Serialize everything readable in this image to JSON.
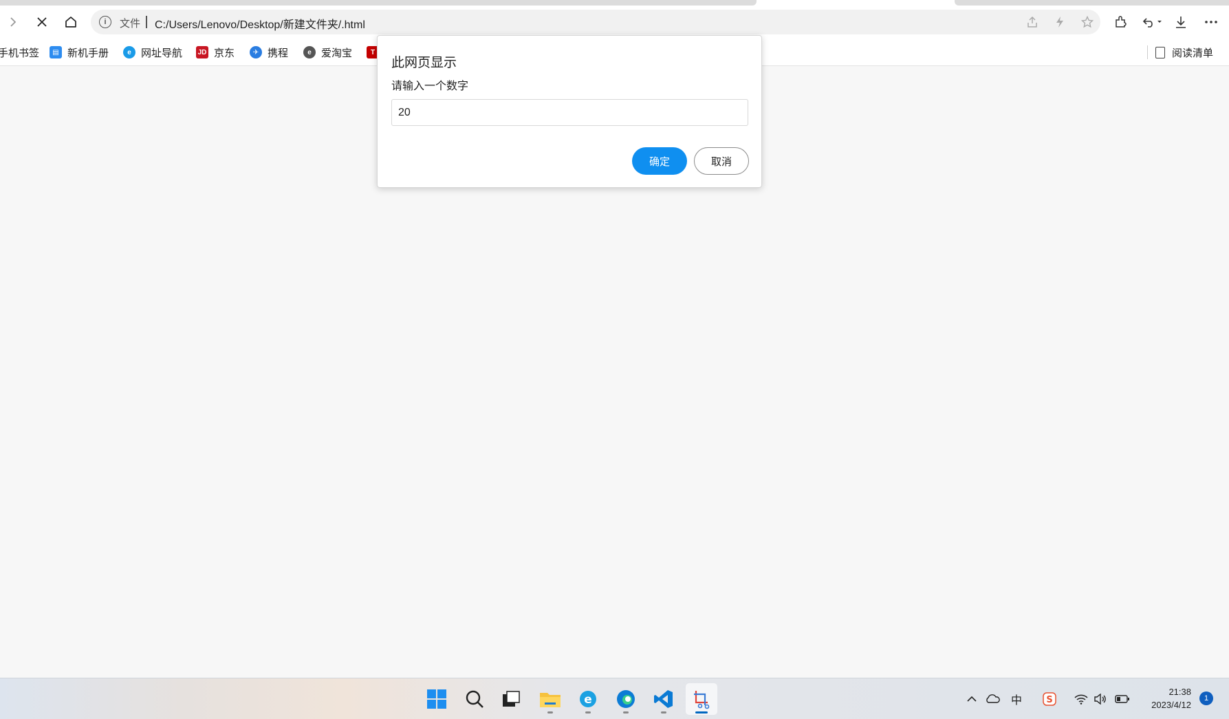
{
  "browser": {
    "address": {
      "file_label": "文件",
      "url": "C:/Users/Lenovo/Desktop/新建文件夹/.html"
    },
    "toolbar_icons": [
      "forward-icon",
      "close-icon",
      "home-icon",
      "info-icon",
      "share-icon",
      "bolt-icon",
      "favorite-star-icon",
      "extensions-icon",
      "undo-icon",
      "download-icon",
      "more-icon"
    ]
  },
  "bookmarks": [
    {
      "label": "手机书签",
      "icon": "phone-bookmark-icon"
    },
    {
      "label": "新机手册",
      "icon": "manual-icon",
      "color": "#2d8cf0"
    },
    {
      "label": "网址导航",
      "icon": "nav-icon",
      "color": "#1a9be8"
    },
    {
      "label": "京东",
      "icon": "jd-icon",
      "color": "#c81623"
    },
    {
      "label": "携程",
      "icon": "ctrip-icon",
      "color": "#2a7de1"
    },
    {
      "label": "爱淘宝",
      "icon": "taobao-icon",
      "color": "#555555"
    },
    {
      "label": "",
      "icon": "tmall-icon",
      "color": "#c40000"
    }
  ],
  "reading_list": {
    "label": "阅读清单"
  },
  "dialog": {
    "title": "此网页显示",
    "message": "请输入一个数字",
    "input_value": "20",
    "ok_label": "确定",
    "cancel_label": "取消",
    "accent": "#0f8ff0"
  },
  "taskbar": {
    "apps": [
      "windows-start-icon",
      "search-icon",
      "task-view-icon",
      "file-explorer-icon",
      "ie-browser-icon",
      "edge-icon",
      "vscode-icon",
      "snipping-tool-icon"
    ],
    "tray": [
      "chevron-up-icon",
      "cloud-icon",
      "input-method-icon",
      "sogou-icon",
      "wifi-icon",
      "volume-icon",
      "battery-icon"
    ],
    "ime_label": "中",
    "time": "21:38",
    "date": "2023/4/12",
    "notification_count": "1"
  }
}
